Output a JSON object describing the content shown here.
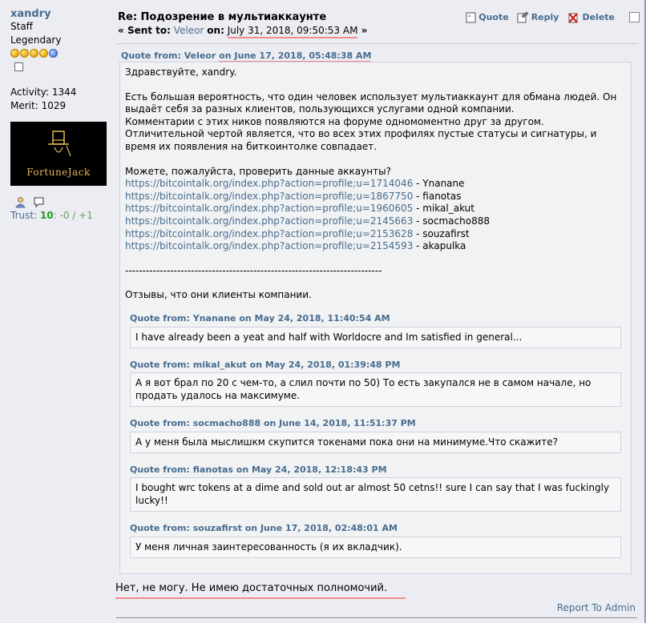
{
  "poster": {
    "name": "xandry",
    "role": "Staff",
    "rank": "Legendary",
    "activity": "Activity: 1344",
    "merit": "Merit: 1029",
    "avatar_text": "FortuneJack",
    "trust_label": "Trust:",
    "trust_score": "10",
    "trust_rest": ": -0 / +1"
  },
  "post": {
    "subject": "Re: Подозрение в мультиаккаунте",
    "sent_prefix": "« ",
    "sent_to_label": "Sent to:",
    "recipient": "Veleor",
    "on_label": "on:",
    "date": "July 31, 2018, 09:50:53 AM",
    "sent_suffix": " »",
    "actions": {
      "quote": "Quote",
      "reply": "Reply",
      "delete": "Delete"
    }
  },
  "outer_quote": {
    "header_prefix": "Quote from: Veleor ",
    "header_date": "on June 17, 2018, 05:48:38 AM",
    "greeting": "Здравствуйте, xandry.",
    "para1": "Есть большая вероятность, что один человек использует мультиаккаунт для обмана людей. Он выдаёт себя за разных клиентов, пользующихся услугами одной компании.",
    "para2": "Комментарии с этих ников появляются на форуме одномоментно друг за другом. Отличительной чертой является, что во всех этих профилях пустые статусы и сигнатуры, и время их появления на биткоинтолке совпадает.",
    "ask": "Можете, пожалуйста, проверить данные аккаунты?",
    "links": [
      {
        "url": "https://bitcointalk.org/index.php?action=profile;u=1714046",
        "name": " - Ynanane"
      },
      {
        "url": "https://bitcointalk.org/index.php?action=profile;u=1867750",
        "name": " - fianotas"
      },
      {
        "url": "https://bitcointalk.org/index.php?action=profile;u=1960605",
        "name": " - mikal_akut"
      },
      {
        "url": "https://bitcointalk.org/index.php?action=profile;u=2145663",
        "name": " - socmacho888"
      },
      {
        "url": "https://bitcointalk.org/index.php?action=profile;u=2153628",
        "name": " - souzafirst"
      },
      {
        "url": "https://bitcointalk.org/index.php?action=profile;u=2154593",
        "name": " - akapulka"
      }
    ],
    "divider": "--------------------------------------------------------------------------",
    "reviews_intro": "Отзывы, что они клиенты компании.",
    "inner_quotes": [
      {
        "header": "Quote from: Ynanane on May 24, 2018, 11:40:54 AM",
        "text": "I have already been a yeat and half with Worldocre and Im satisfied in general..."
      },
      {
        "header": "Quote from: mikal_akut on May 24, 2018, 01:39:48 PM",
        "text": "А я вот брал по 20 с чем-то, а слил почти по 50) То есть закупался не в самом начале, но продать удалось на максимуме."
      },
      {
        "header": "Quote from: socmacho888 on June 14, 2018, 11:51:37 PM",
        "text": "А у меня была мыслишкм скупится токенами пока они на минимуме.Что скажите?"
      },
      {
        "header": "Quote from: fianotas on May 24, 2018, 12:18:43 PM",
        "text": "I bought wrc tokens at a dime and sold out ar almost 50 cetns!! sure I can say that I was fuckingly lucky!!"
      },
      {
        "header": "Quote from: souzafirst on June 17, 2018, 02:48:01 AM",
        "text": "У меня личная заинтересованность (я их вкладчик)."
      }
    ]
  },
  "reply_text": "Нет, не могу. Не имею достаточных полномочий.",
  "report": "Report To Admin",
  "colors": {
    "link": "#476c8e",
    "underline_mark": "#f08c8c",
    "trust_good": "#1e9a1e"
  }
}
